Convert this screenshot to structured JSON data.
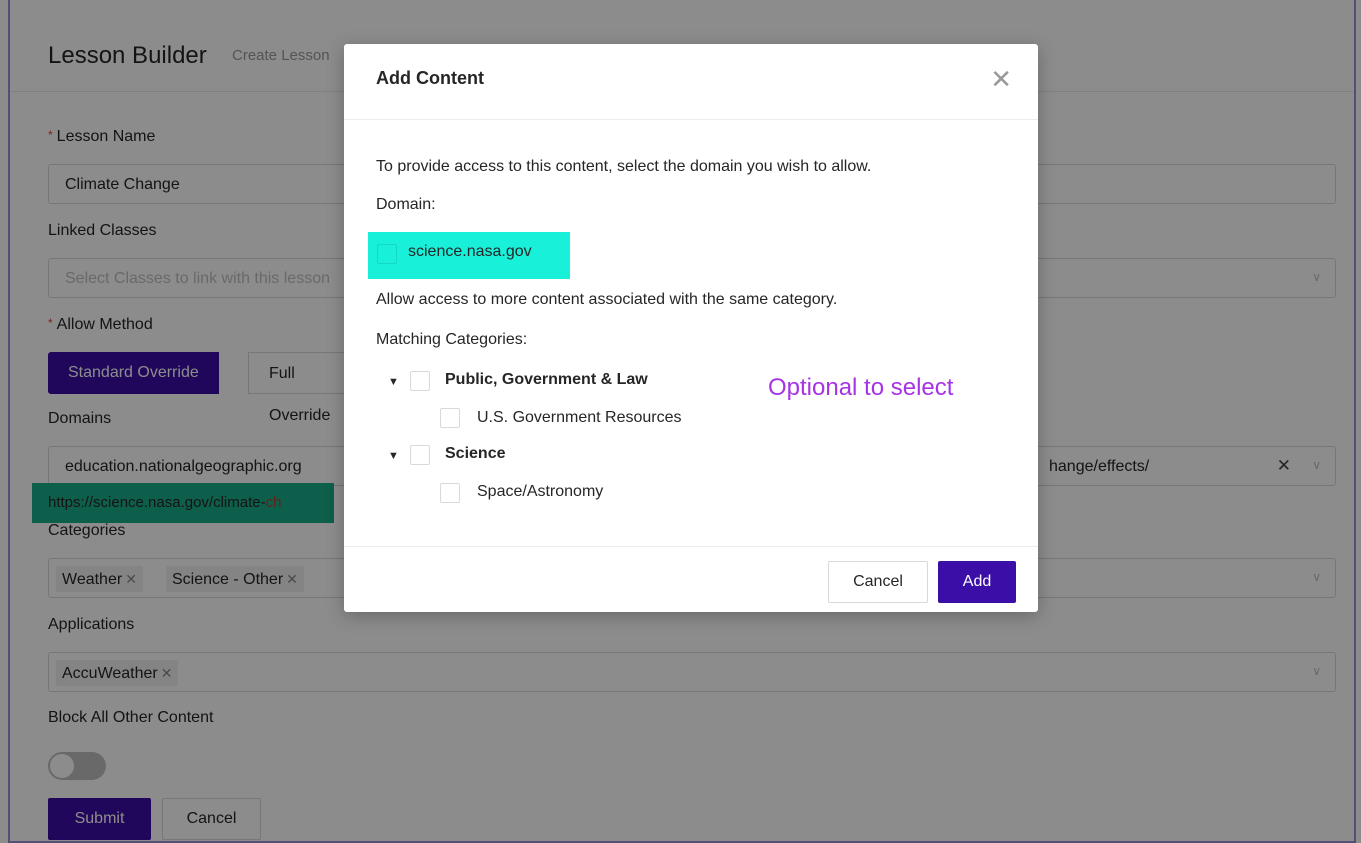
{
  "page": {
    "title": "Lesson Builder",
    "subtitle": "Create Lesson"
  },
  "form": {
    "lesson_name_label": "Lesson Name",
    "lesson_name_value": "Climate Change",
    "linked_classes_label": "Linked Classes",
    "linked_classes_placeholder": "Select Classes to link with this lesson",
    "allow_method_label": "Allow Method",
    "allow_method_options": [
      "Standard Override",
      "Full Override"
    ],
    "domains_label": "Domains",
    "domains_value_left": "education.nationalgeographic.org",
    "domains_value_right": "hange/effects/",
    "domain_url_prefix": "https://science.nasa.gov/climate-",
    "domain_url_suffix": "ch",
    "categories_label": "Categories",
    "categories_tags": [
      "Weather",
      "Science - Other"
    ],
    "applications_label": "Applications",
    "applications_tags": [
      "AccuWeather"
    ],
    "block_all_label": "Block All Other Content",
    "block_all_enabled": false,
    "submit_label": "Submit",
    "cancel_label": "Cancel"
  },
  "modal": {
    "title": "Add Content",
    "close_glyph": "✕",
    "instruction": "To provide access to this content, select the domain you wish to allow.",
    "domain_label": "Domain:",
    "domain_option": "science.nasa.gov",
    "more_access_text": "Allow access to more content associated with the same category.",
    "matching_label": "Matching Categories:",
    "categories": [
      {
        "label": "Public, Government & Law",
        "children": [
          "U.S. Government Resources"
        ]
      },
      {
        "label": "Science",
        "children": [
          "Space/Astronomy"
        ]
      }
    ],
    "note": "Optional to select",
    "cancel_label": "Cancel",
    "add_label": "Add"
  },
  "colors": {
    "primary": "#3b0ea7",
    "highlight_cyan": "#19f0d9",
    "highlight_green": "#1aab8a",
    "note_purple": "#a733e6"
  }
}
